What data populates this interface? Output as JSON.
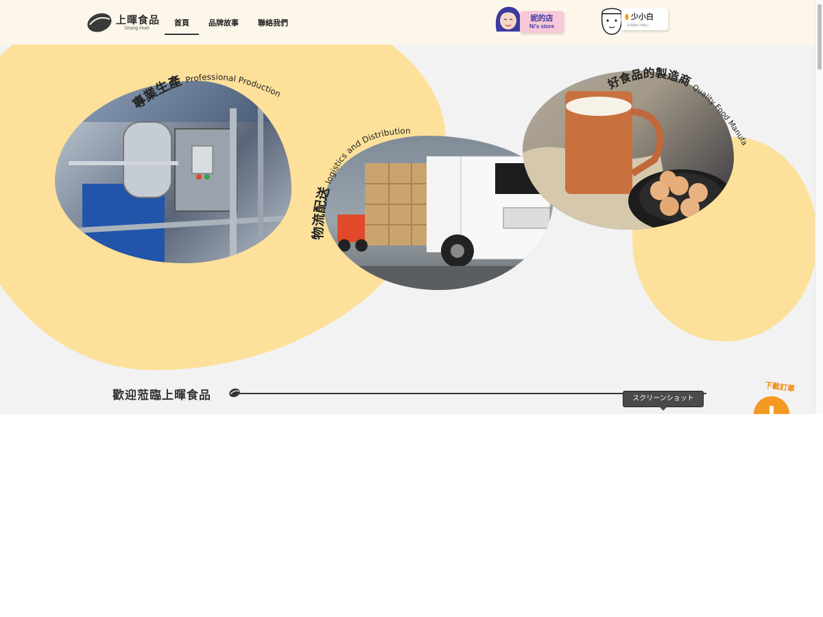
{
  "header": {
    "logo_title": "上暉食品",
    "logo_subtitle": "Shang Huei",
    "nav": [
      {
        "label": "首頁",
        "active": true
      },
      {
        "label": "品牌故事",
        "active": false
      },
      {
        "label": "聯絡我們",
        "active": false
      }
    ],
    "stores": {
      "ni": {
        "title": "妮的店",
        "subtitle": "Ni's store"
      },
      "shaoxiaobai": {
        "title": "少小白",
        "tagline": "全家最安心的點心"
      }
    }
  },
  "hero": {
    "production": {
      "zh": "專業生產",
      "en": "Professional Production"
    },
    "logistics": {
      "zh": "物流配送",
      "en": "logistics and Distribution"
    },
    "manufacturer": {
      "zh": "好食品的製造商",
      "en": "Quality Food Manufacturer"
    }
  },
  "welcome": {
    "title": "歡迎蒞臨上暉食品"
  },
  "tooltip": {
    "label": "スクリーンショット"
  },
  "download": {
    "label": "下載訂單"
  },
  "colors": {
    "accent": "#fde09a",
    "header_bg": "#fdf6ea",
    "page_bg": "#f2f2f2",
    "download": "#f49a22"
  }
}
